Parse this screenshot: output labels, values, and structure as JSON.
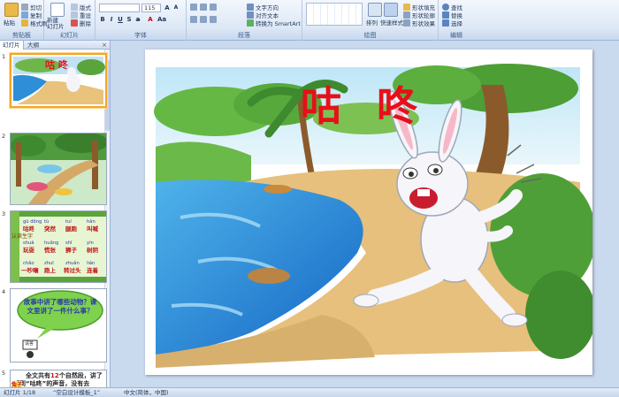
{
  "ribbon": {
    "groups": [
      {
        "label": "剪贴板",
        "buttons": [
          "粘贴",
          "剪切",
          "复制",
          "格式刷"
        ]
      },
      {
        "label": "幻灯片",
        "buttons": [
          "新建\n幻灯片",
          "版式",
          "重设",
          "删除"
        ]
      },
      {
        "label": "字体",
        "font_size": "115"
      },
      {
        "label": "段落",
        "buttons": [
          "文字方向",
          "对齐文本",
          "转换为 SmartArt"
        ]
      },
      {
        "label": "绘图",
        "buttons": [
          "排列",
          "快速样式",
          "形状填充",
          "形状轮廓",
          "形状效果"
        ]
      },
      {
        "label": "编辑",
        "buttons": [
          "查找",
          "替换",
          "选择"
        ]
      }
    ]
  },
  "left_pane": {
    "tabs": [
      "幻灯片",
      "大纲"
    ],
    "close": "×",
    "slides": [
      {
        "num": "1",
        "title": "咕 咚"
      },
      {
        "num": "2"
      },
      {
        "num": "3",
        "rows": [
          [
            "gū dōng",
            "tù",
            "tuí",
            "hǎn"
          ],
          [
            "咕咚",
            "突然",
            "腿跑",
            "叫喊"
          ],
          [
            "shuā",
            "huǎng",
            "shī",
            "yín"
          ],
          [
            "玩耍",
            "慌张",
            "狮子",
            "树阴"
          ],
          [
            "chǎo",
            "zhuī",
            "zhuǎn",
            "lián"
          ],
          [
            "一吵嚷",
            "跑上",
            "转过头",
            "连着"
          ]
        ],
        "side_label": "认读生字"
      },
      {
        "num": "4",
        "bubble": "故事中讲了哪些动物？课文里讲了一件什么事？",
        "sign": "请答"
      },
      {
        "num": "5",
        "text_a": "全文共有",
        "text_num": "12",
        "text_b": "个自然段，讲了听到“咕咚”的声音，没有去",
        "highlight": "兔子"
      }
    ]
  },
  "slide": {
    "title": "咕 咚"
  },
  "statusbar": {
    "slide_pos": "幻灯片 1/18",
    "theme": "“空白设计模板_1”",
    "language": "中文(简体，中国)"
  }
}
